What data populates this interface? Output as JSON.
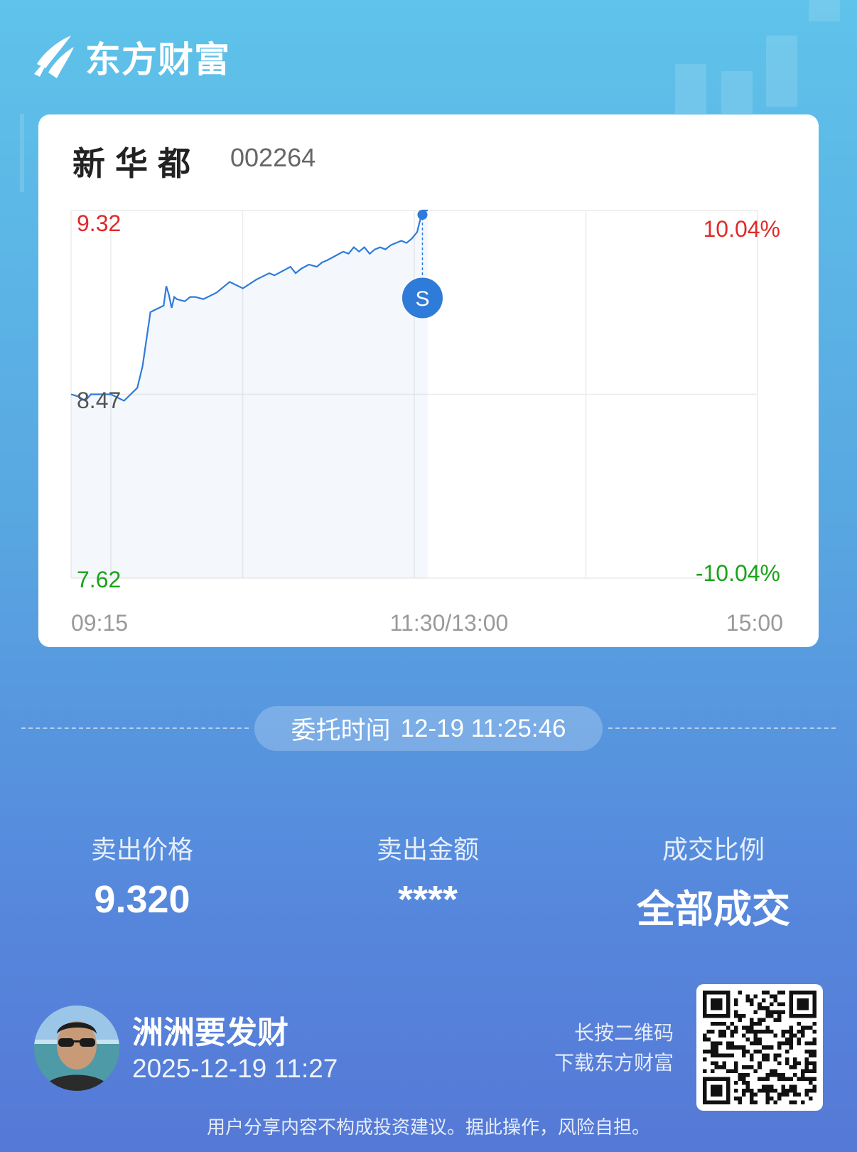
{
  "brand": {
    "name": "东方财富"
  },
  "stock": {
    "name": "新华都",
    "code": "002264"
  },
  "chart_data": {
    "type": "line",
    "y_labels": {
      "high": "9.32",
      "mid": "8.47",
      "low": "7.62"
    },
    "pct_labels": {
      "high": "10.04%",
      "low": "-10.04%"
    },
    "x_tick_labels": [
      "09:15",
      "11:30/13:00",
      "15:00"
    ],
    "ylim": [
      7.62,
      9.32
    ],
    "colors": {
      "up": "#e02a2a",
      "down": "#1aa31a",
      "line": "#2f7bd9"
    },
    "series": [
      {
        "x_minutes_from_0930": [
          0,
          5,
          10,
          12,
          15,
          20,
          21,
          22,
          23,
          24,
          25,
          28,
          30,
          32,
          35,
          40,
          45,
          50,
          55,
          60,
          62,
          65,
          68,
          70,
          72,
          75,
          78,
          80,
          82,
          85,
          88,
          90,
          92,
          94,
          96,
          98,
          100,
          102,
          104,
          106,
          108,
          110,
          112,
          114,
          116,
          118,
          119,
          120
        ],
        "values": [
          8.47,
          8.44,
          8.5,
          8.6,
          8.85,
          8.88,
          8.97,
          8.93,
          8.87,
          8.92,
          8.91,
          8.9,
          8.92,
          8.92,
          8.91,
          8.94,
          8.99,
          8.96,
          9.0,
          9.03,
          9.02,
          9.04,
          9.06,
          9.03,
          9.05,
          9.07,
          9.06,
          9.08,
          9.09,
          9.11,
          9.13,
          9.12,
          9.15,
          9.13,
          9.15,
          9.12,
          9.14,
          9.15,
          9.14,
          9.16,
          9.17,
          9.18,
          9.17,
          9.19,
          9.22,
          9.32,
          9.32,
          9.32
        ]
      }
    ],
    "marker": {
      "label": "S",
      "x_minutes_from_0930": 116,
      "value": 9.32
    }
  },
  "order": {
    "label": "委托时间",
    "time": "12-19 11:25:46"
  },
  "stats": [
    {
      "label": "卖出价格",
      "value": "9.320"
    },
    {
      "label": "卖出金额",
      "value": "****"
    },
    {
      "label": "成交比例",
      "value": "全部成交"
    }
  ],
  "user": {
    "name": "洲洲要发财",
    "time": "2025-12-19 11:27"
  },
  "qr": {
    "hint_line1": "长按二维码",
    "hint_line2": "下载东方财富"
  },
  "disclaimer": "用户分享内容不构成投资建议。据此操作，风险自担。"
}
